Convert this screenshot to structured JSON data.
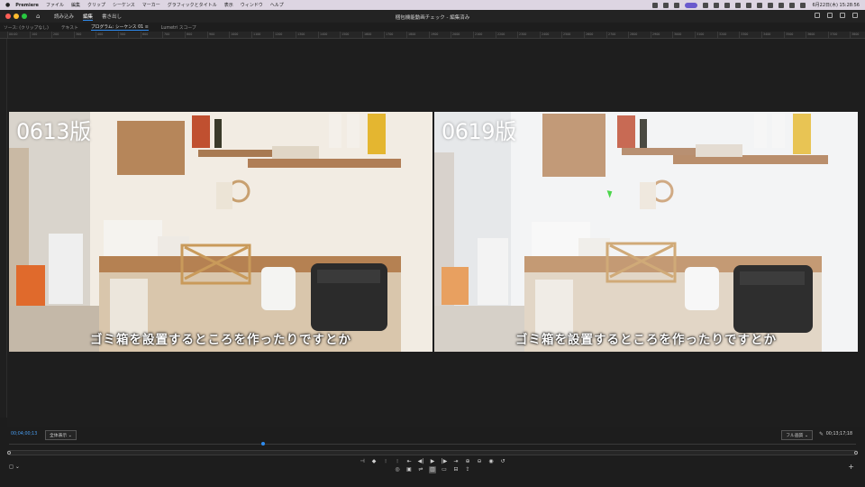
{
  "menubar": {
    "apple": "",
    "items": [
      "Premiere",
      "ファイル",
      "編集",
      "クリップ",
      "シーケンス",
      "マーカー",
      "グラフィックとタイトル",
      "表示",
      "ウィンドウ",
      "ヘルプ"
    ],
    "date": "6月22日(木)  15:28:56"
  },
  "titlebar": {
    "home_icon": "home-icon",
    "tabs": [
      "読み込み",
      "編集",
      "書き出し"
    ],
    "active_tab": "編集",
    "title": "梱包機能動画チェック - 編集済み"
  },
  "panel_tabs": [
    "ソース: (クリップなし)",
    "テキスト",
    "プログラム: シーケンス 01  ≡",
    "Lumetri スコープ"
  ],
  "ruler_labels": [
    "00:00",
    "100",
    "200",
    "300",
    "400",
    "500",
    "600",
    "700",
    "800",
    "900",
    "1000",
    "1100",
    "1200",
    "1300",
    "1400",
    "1500",
    "1600",
    "1700",
    "1800",
    "1900",
    "2000",
    "2100",
    "2200",
    "2300",
    "2400",
    "2500",
    "2600",
    "2700",
    "2800",
    "2900",
    "3000",
    "3100",
    "3200",
    "3300",
    "3400",
    "3500",
    "3600",
    "3700",
    "3800"
  ],
  "videos": [
    {
      "label": "0613版",
      "subtitle": "ゴミ箱を設置するところを作ったりですとか"
    },
    {
      "label": "0619版",
      "subtitle": "ゴミ箱を設置するところを作ったりですとか"
    }
  ],
  "timecode_bar": {
    "current": "00;04;00;13",
    "fit": "全体表示",
    "quality": "フル画質",
    "duration": "00;13;17;18"
  },
  "transport": {
    "row1": [
      "⊣",
      "◆",
      "⦙",
      "⦙",
      "⇤",
      "◀|",
      "▶",
      "|▶",
      "⇥",
      "⊕",
      "⊖",
      "◉",
      "↺"
    ],
    "row2": [
      "◎",
      "▣",
      "⇌",
      "▥",
      "▭",
      "⊟",
      "⇪"
    ]
  },
  "colors": {
    "accent": "#2f8cf0",
    "cursor": "#4cd64c"
  }
}
